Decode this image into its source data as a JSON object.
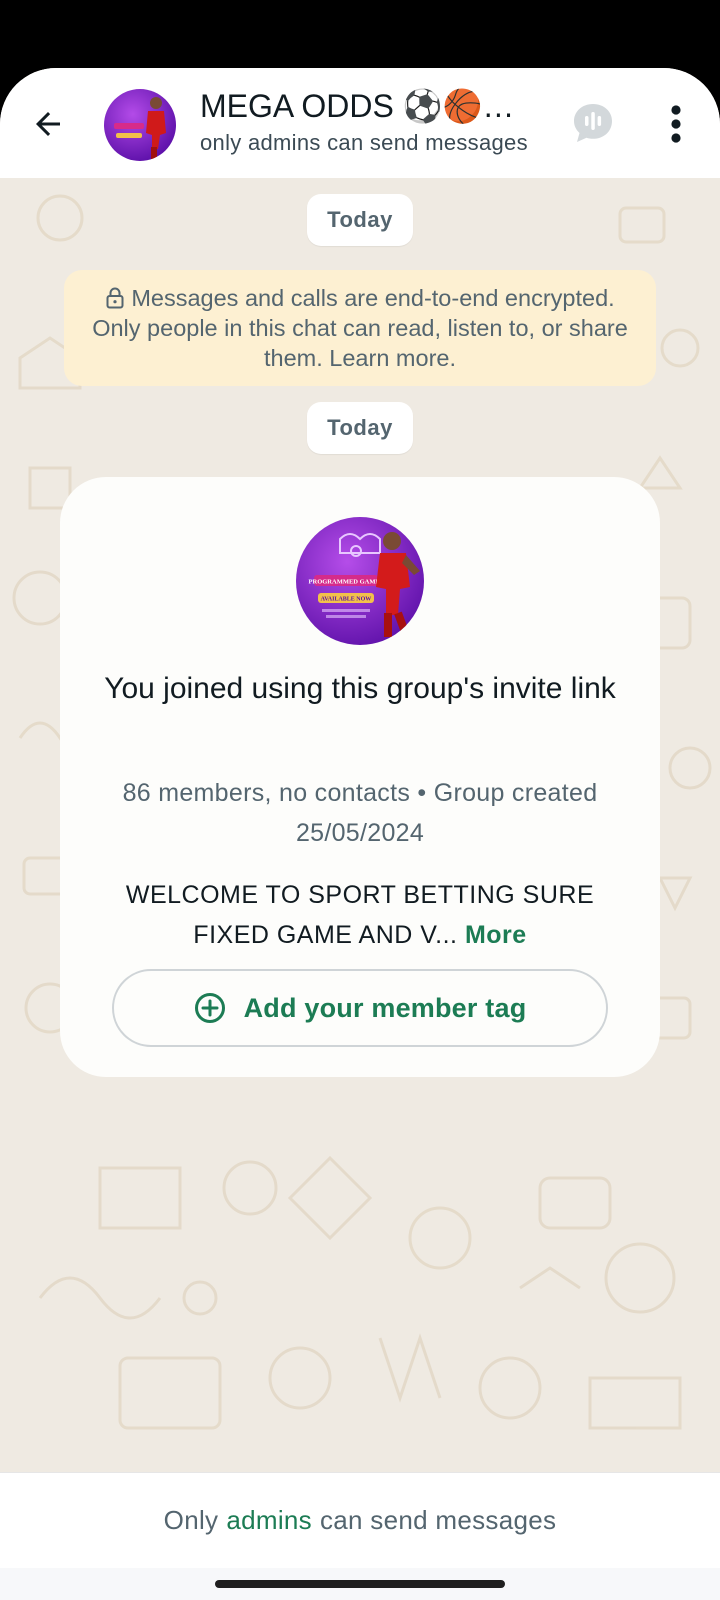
{
  "header": {
    "title": "MEGA ODDS ⚽🏀🏈⚾",
    "subtitle": "only admins can send messages",
    "back_icon": "arrow-left-icon",
    "voice_chat_icon": "voice-chat-icon",
    "menu_icon": "more-vertical-icon"
  },
  "chat": {
    "date_label_1": "Today",
    "encryption_notice": "Messages and calls are end-to-end encrypted. Only people in this chat can read, listen to, or share them. Learn more.",
    "date_label_2": "Today"
  },
  "group_card": {
    "title": "You joined using this group's invite link",
    "meta": "86 members, no contacts • Group created 25/05/2024",
    "description": "WELCOME TO SPORT BETTING SURE FIXED GAME AND V...",
    "more_label": "More",
    "member_tag_label": "Add your member tag",
    "member_tag_icon": "plus-circle-icon",
    "avatar_text_1": "PROGRAMMED GAMES",
    "avatar_text_2": "AVAILABLE NOW"
  },
  "footer": {
    "prefix": "Only",
    "admins_link": "admins",
    "suffix": "can send messages"
  },
  "colors": {
    "accent_green": "#1c7c54",
    "wallpaper": "#efeae2",
    "notice_bg": "#fdf0d2"
  }
}
